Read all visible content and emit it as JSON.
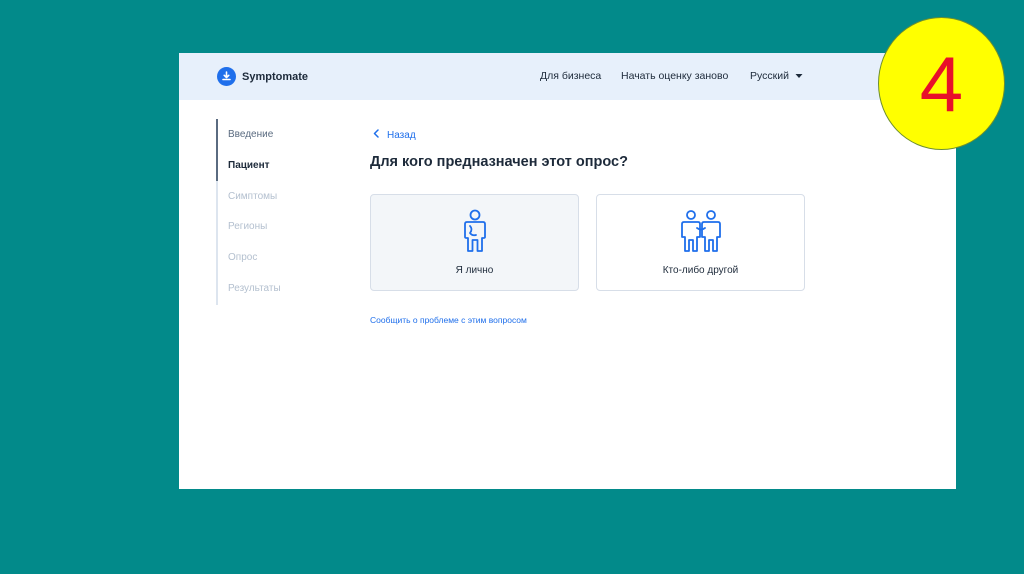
{
  "header": {
    "brand": "Symptomate",
    "nav": {
      "business": "Для бизнеса",
      "restart": "Начать оценку заново",
      "language": "Русский"
    }
  },
  "sidebar": {
    "items": [
      {
        "label": "Введение",
        "state": "done"
      },
      {
        "label": "Пациент",
        "state": "current"
      },
      {
        "label": "Симптомы",
        "state": "todo"
      },
      {
        "label": "Регионы",
        "state": "todo"
      },
      {
        "label": "Опрос",
        "state": "todo"
      },
      {
        "label": "Результаты",
        "state": "todo"
      }
    ]
  },
  "main": {
    "back_label": "Назад",
    "question": "Для кого предназначен этот опрос?",
    "options": [
      {
        "label": "Я лично",
        "icon": "person-icon",
        "selected": true
      },
      {
        "label": "Кто-либо другой",
        "icon": "two-people-icon",
        "selected": false
      }
    ],
    "report_link": "Сообщить о проблеме с этим вопросом"
  },
  "badge": {
    "number": "4"
  },
  "colors": {
    "slide_background": "#028a8a",
    "accent": "#1f6feb",
    "header_background": "#e7f0fb",
    "badge_fill": "#ffff00",
    "badge_number": "#e8102a"
  }
}
